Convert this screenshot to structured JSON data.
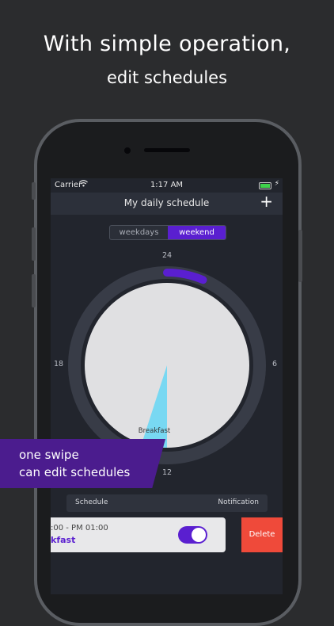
{
  "headline": {
    "line1": "With simple operation,",
    "line2": "edit schedules"
  },
  "status_bar": {
    "carrier": "Carrier",
    "wifi_icon": "wifi-icon",
    "time": "1:17 AM",
    "battery_icon": "battery-charging-icon"
  },
  "nav": {
    "title": "My daily schedule",
    "add_icon": "plus-icon"
  },
  "segments": {
    "weekdays": "weekdays",
    "weekend": "weekend",
    "selected": "weekend"
  },
  "clock": {
    "top": "24",
    "right": "6",
    "bottom": "12",
    "left": "18",
    "slice_label": "Breakfast"
  },
  "schedule_header": {
    "schedule": "Schedule",
    "notification": "Notification"
  },
  "schedule_item": {
    "time": ":00 - PM 01:00",
    "name": "kfast",
    "notification_on": true
  },
  "delete_label": "Delete",
  "banner": {
    "line1": "one swipe",
    "line2": "can edit schedules"
  },
  "colors": {
    "accent": "#5a1fd0",
    "delete": "#ef4a3a",
    "breakfast_slice": "#78d8f2",
    "banner": "#4b1c8e"
  }
}
